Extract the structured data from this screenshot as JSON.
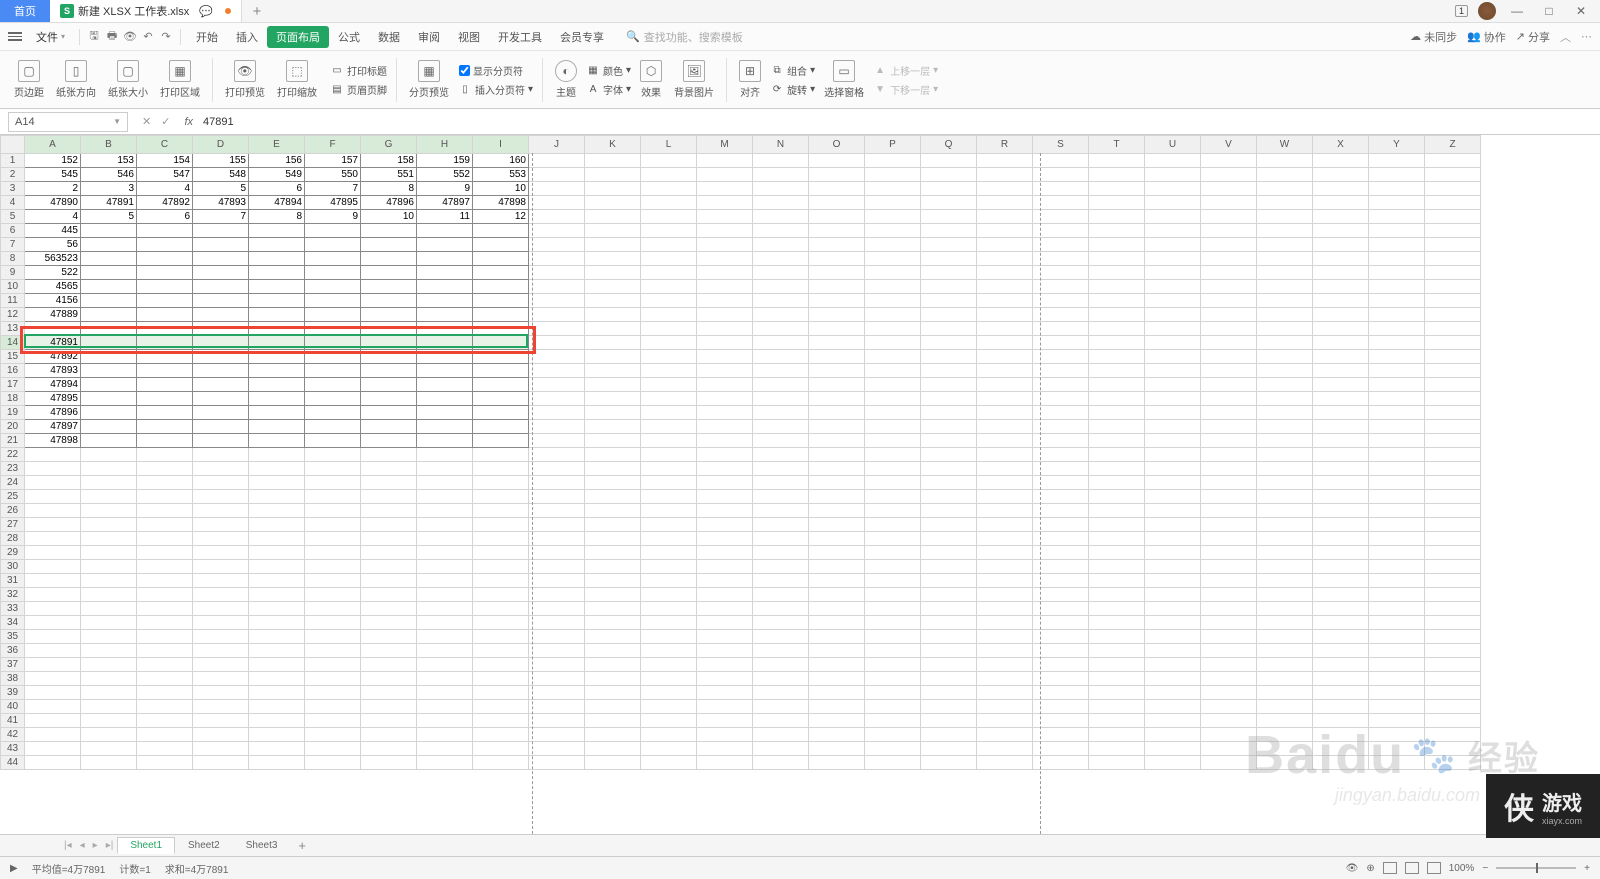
{
  "titlebar": {
    "home": "首页",
    "filename": "新建 XLSX 工作表.xlsx",
    "boxnum": "1"
  },
  "menubar": {
    "file": "文件",
    "tabs": [
      "开始",
      "插入",
      "页面布局",
      "公式",
      "数据",
      "审阅",
      "视图",
      "开发工具",
      "会员专享"
    ],
    "active_tab": "页面布局",
    "search_placeholder": "查找功能、搜索模板",
    "right": {
      "sync": "未同步",
      "coop": "协作",
      "share": "分享"
    }
  },
  "ribbon": {
    "margin": "页边距",
    "orient": "纸张方向",
    "size": "纸张大小",
    "area": "打印区域",
    "preview": "打印预览",
    "scale": "打印缩放",
    "print_title": "打印标题",
    "header_footer": "页眉页脚",
    "breaks_preview": "分页预览",
    "show_breaks": "显示分页符",
    "insert_break": "插入分页符",
    "theme": "主题",
    "colors": "颜色",
    "fonts": "字体",
    "effects": "效果",
    "bgimg": "背景图片",
    "align": "对齐",
    "group": "组合",
    "rotate": "旋转",
    "selpane": "选择窗格",
    "bring_fwd": "上移一层",
    "send_back": "下移一层"
  },
  "formula": {
    "namebox": "A14",
    "value": "47891"
  },
  "columns": [
    "A",
    "B",
    "C",
    "D",
    "E",
    "F",
    "G",
    "H",
    "I",
    "J",
    "K",
    "L",
    "M",
    "N",
    "O",
    "P",
    "Q",
    "R",
    "S",
    "T",
    "U",
    "V",
    "W",
    "X",
    "Y",
    "Z"
  ],
  "rows_data": {
    "1": [
      "152",
      "153",
      "154",
      "155",
      "156",
      "157",
      "158",
      "159",
      "160"
    ],
    "2": [
      "545",
      "546",
      "547",
      "548",
      "549",
      "550",
      "551",
      "552",
      "553"
    ],
    "3": [
      "2",
      "3",
      "4",
      "5",
      "6",
      "7",
      "8",
      "9",
      "10"
    ],
    "4": [
      "47890",
      "47891",
      "47892",
      "47893",
      "47894",
      "47895",
      "47896",
      "47897",
      "47898"
    ],
    "5": [
      "4",
      "5",
      "6",
      "7",
      "8",
      "9",
      "10",
      "11",
      "12"
    ],
    "6": [
      "445"
    ],
    "7": [
      "56"
    ],
    "8": [
      "563523"
    ],
    "9": [
      "522"
    ],
    "10": [
      "4565"
    ],
    "11": [
      "4156"
    ],
    "12": [
      "47889"
    ],
    "13": [
      ""
    ],
    "14": [
      "47891"
    ],
    "15": [
      "47892"
    ],
    "16": [
      "47893"
    ],
    "17": [
      "47894"
    ],
    "18": [
      "47895"
    ],
    "19": [
      "47896"
    ],
    "20": [
      "47897"
    ],
    "21": [
      "47898"
    ]
  },
  "total_rows": 44,
  "bordered_until_row": 21,
  "selected_row": 14,
  "highlight_cols": 9,
  "sheets": [
    "Sheet1",
    "Sheet2",
    "Sheet3"
  ],
  "active_sheet": "Sheet1",
  "statusbar": {
    "avg": "平均值=4万7891",
    "count": "计数=1",
    "sum": "求和=4万7891",
    "zoom": "100%"
  },
  "watermark": {
    "text": "Baidu",
    "sub": "经验",
    "url": "jingyan.baidu.com"
  },
  "badge": {
    "logo": "侠",
    "text": "游戏",
    "site": "xiayx.com"
  }
}
